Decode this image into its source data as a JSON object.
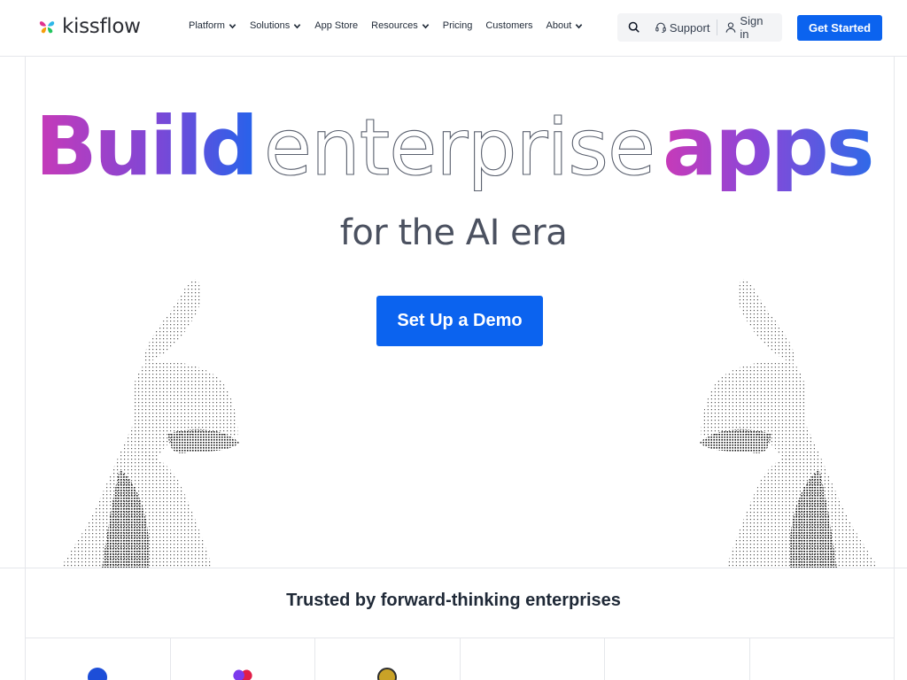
{
  "header": {
    "brand": "kissflow",
    "nav": [
      {
        "label": "Platform",
        "has_dropdown": true
      },
      {
        "label": "Solutions",
        "has_dropdown": true
      },
      {
        "label": "App Store",
        "has_dropdown": false
      },
      {
        "label": "Resources",
        "has_dropdown": true
      },
      {
        "label": "Pricing",
        "has_dropdown": false
      },
      {
        "label": "Customers",
        "has_dropdown": false
      },
      {
        "label": "About",
        "has_dropdown": true
      }
    ],
    "support_label": "Support",
    "signin_label": "Sign in",
    "cta_label": "Get Started"
  },
  "hero": {
    "title_bold_1": "Build",
    "title_thin": "enterprise",
    "title_bold_2": "apps",
    "subtitle": "for the AI era",
    "button_label": "Set Up a Demo"
  },
  "trusted": {
    "heading": "Trusted by forward-thinking enterprises"
  },
  "colors": {
    "primary": "#0b63ef",
    "gradient_pink": "#c83ab8",
    "gradient_purple": "#7d47d6",
    "gradient_blue": "#2563eb",
    "text_dark": "#1f2937",
    "text_muted": "#4b5160"
  },
  "icons": {
    "brand": "butterfly-logo-icon",
    "search": "search-icon",
    "support": "headset-icon",
    "signin": "user-icon",
    "dropdown": "chevron-down-icon"
  }
}
